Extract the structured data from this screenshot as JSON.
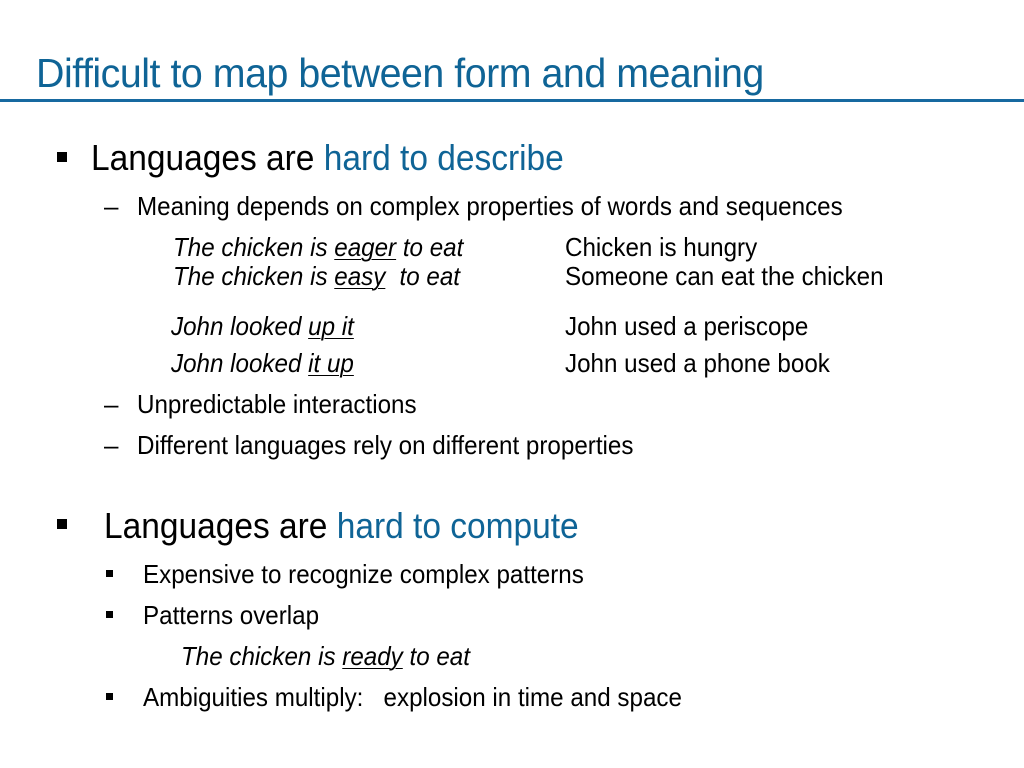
{
  "slide": {
    "title": "Difficult to map between form and meaning",
    "accent_color": "#0f6496",
    "section1": {
      "prefix": "Languages are ",
      "highlight": "hard to describe",
      "items": [
        {
          "marker": "–",
          "text": "Meaning depends on complex properties of words and sequences"
        },
        {
          "marker": "–",
          "text": "Unpredictable interactions"
        },
        {
          "marker": "–",
          "text": "Different languages rely on different properties"
        }
      ],
      "examples": [
        {
          "pre": "The chicken is ",
          "underlined": "eager",
          "post": " to eat",
          "meaning": "Chicken is hungry"
        },
        {
          "pre": "The chicken is ",
          "underlined": "easy",
          "post": " to eat",
          "meaning": "Someone can eat the chicken"
        },
        {
          "pre": "John looked ",
          "underlined": "up it",
          "post": "",
          "meaning": "John used a periscope"
        },
        {
          "pre": "John looked ",
          "underlined": "it up",
          "post": "",
          "meaning": "John used a phone book"
        }
      ]
    },
    "section2": {
      "prefix": "Languages are ",
      "highlight": "hard to compute",
      "items": [
        {
          "text": "Expensive to recognize complex patterns"
        },
        {
          "text": "Patterns overlap"
        },
        {
          "text": "Ambiguities multiply:   explosion in time and space"
        }
      ],
      "example": {
        "pre": "The chicken is ",
        "underlined": "ready",
        "post": " to eat"
      }
    }
  }
}
